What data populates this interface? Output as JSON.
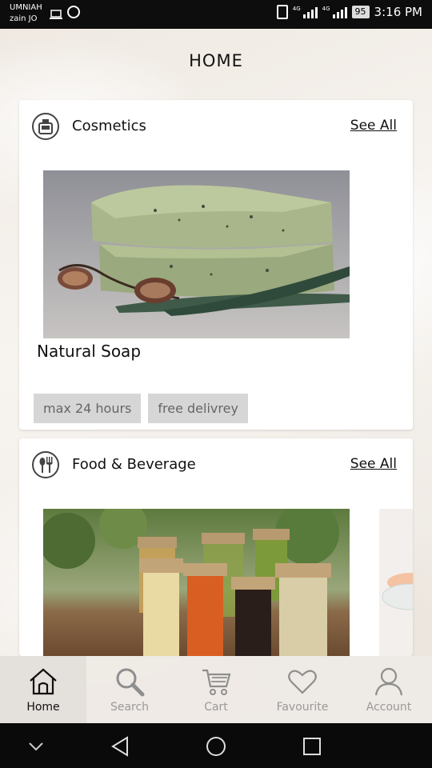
{
  "status_bar": {
    "carrier_1": "UMNIAH",
    "carrier_2": "zain JO",
    "network_1": "4G",
    "network_2": "4G",
    "battery": "95",
    "time": "3:16 PM"
  },
  "header": {
    "title": "HOME"
  },
  "sections": [
    {
      "title": "Cosmetics",
      "icon": "cosmetics-icon",
      "see_all": "See All",
      "product": {
        "name": "Natural Soap",
        "tags": [
          "max 24 hours",
          "free delivrey"
        ]
      }
    },
    {
      "title": "Food & Beverage",
      "icon": "food-beverage-icon",
      "see_all": "See All"
    }
  ],
  "bottom_nav": {
    "items": [
      {
        "label": "Home",
        "icon": "home-icon",
        "active": true
      },
      {
        "label": "Search",
        "icon": "search-icon",
        "active": false
      },
      {
        "label": "Cart",
        "icon": "cart-icon",
        "active": false
      },
      {
        "label": "Favourite",
        "icon": "heart-icon",
        "active": false
      },
      {
        "label": "Account",
        "icon": "account-icon",
        "active": false
      }
    ]
  }
}
